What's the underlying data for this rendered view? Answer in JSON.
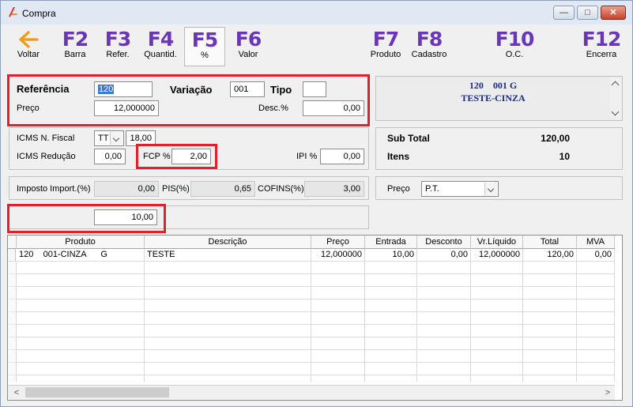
{
  "window": {
    "title": "Compra",
    "controls": {
      "minimize": "—",
      "maximize": "□",
      "close": "✕"
    }
  },
  "toolbar": [
    {
      "key": "",
      "label": "Voltar",
      "icon": "back-arrow-icon"
    },
    {
      "key": "F2",
      "label": "Barra"
    },
    {
      "key": "F3",
      "label": "Refer."
    },
    {
      "key": "F4",
      "label": "Quantid."
    },
    {
      "key": "F5",
      "label": "%"
    },
    {
      "key": "F6",
      "label": "Valor"
    },
    {
      "key": "F7",
      "label": "Produto"
    },
    {
      "key": "F8",
      "label": "Cadastro"
    },
    {
      "key": "F10",
      "label": "O.C."
    },
    {
      "key": "F12",
      "label": "Encerra"
    }
  ],
  "form": {
    "referencia_label": "Referência",
    "referencia_value": "120",
    "variacao_label": "Variação",
    "variacao_value": "001",
    "tipo_label": "Tipo",
    "tipo_value": "",
    "preco_label": "Preço",
    "preco_value": "12,000000",
    "desc_label": "Desc.%",
    "desc_value": "0,00",
    "icms_nf_label": "ICMS N. Fiscal",
    "icms_nf_code": "TT",
    "icms_nf_value": "18,00",
    "icms_red_label": "ICMS Redução",
    "icms_red_value": "0,00",
    "fcp_label": "FCP %",
    "fcp_value": "2,00",
    "ipi_label": "IPI %",
    "ipi_value": "0,00",
    "imp_label": "Imposto Import.(%)",
    "imp_value": "0,00",
    "pis_label": "PIS(%)",
    "pis_value": "0,65",
    "cofins_label": "COFINS(%)",
    "cofins_value": "3,00",
    "qty_value": "10,00"
  },
  "info": {
    "line1": "120    001 G",
    "line2": "TESTE-CINZA"
  },
  "summary": {
    "subtotal_label": "Sub Total",
    "subtotal_value": "120,00",
    "itens_label": "Itens",
    "itens_value": "10"
  },
  "price": {
    "label": "Preço",
    "selected": "P.T."
  },
  "table": {
    "columns": [
      "Produto",
      "Descrição",
      "Preço",
      "Entrada",
      "Desconto",
      "Vr.Líquido",
      "Total",
      "MVA"
    ],
    "row": {
      "produto": "120    001-CINZA      G",
      "descricao": "TESTE",
      "preco": "12,000000",
      "entrada": "10,00",
      "desconto": "0,00",
      "vr_liquido": "12,000000",
      "total": "120,00",
      "mva": "0,00"
    }
  },
  "colors": {
    "accent_fkey": "#6a35b8",
    "highlight_red": "#e2202b",
    "info_text": "#1a2a8c"
  }
}
